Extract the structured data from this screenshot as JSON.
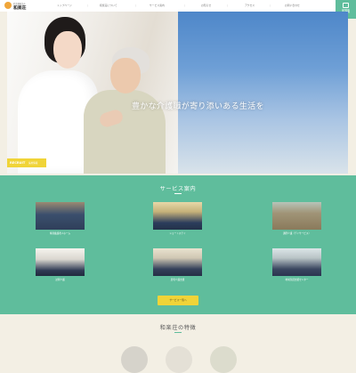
{
  "header": {
    "logo": {
      "small": "社会福祉法人",
      "name": "和楽荘",
      "sub": "WARAKUSOU"
    },
    "nav": [
      "トップページ",
      "和楽荘について",
      "サービス案内",
      "お知らせ",
      "アクセス",
      "お問い合わせ"
    ],
    "recruit_tab": "採用情報\n求人情報"
  },
  "hero": {
    "copy": "豊かな介護職が寄り添いある生活を",
    "recruit_badge": "RECRUIT",
    "recruit_badge_sub": "採用情報"
  },
  "services": {
    "title": "サービス案内",
    "cards": [
      {
        "label": "特別養護老人ホーム"
      },
      {
        "label": "ショートステイ"
      },
      {
        "label": "通所介護（デイサービス）"
      },
      {
        "label": "訪問介護"
      },
      {
        "label": "居宅介護支援"
      },
      {
        "label": "地域包括支援センター"
      }
    ],
    "more_button": "サービス一覧へ"
  },
  "features": {
    "title": "和楽荘の特徴"
  },
  "colors": {
    "brand_green": "#5fbd9c",
    "accent_yellow": "#f0d438",
    "background": "#f3efe4"
  }
}
